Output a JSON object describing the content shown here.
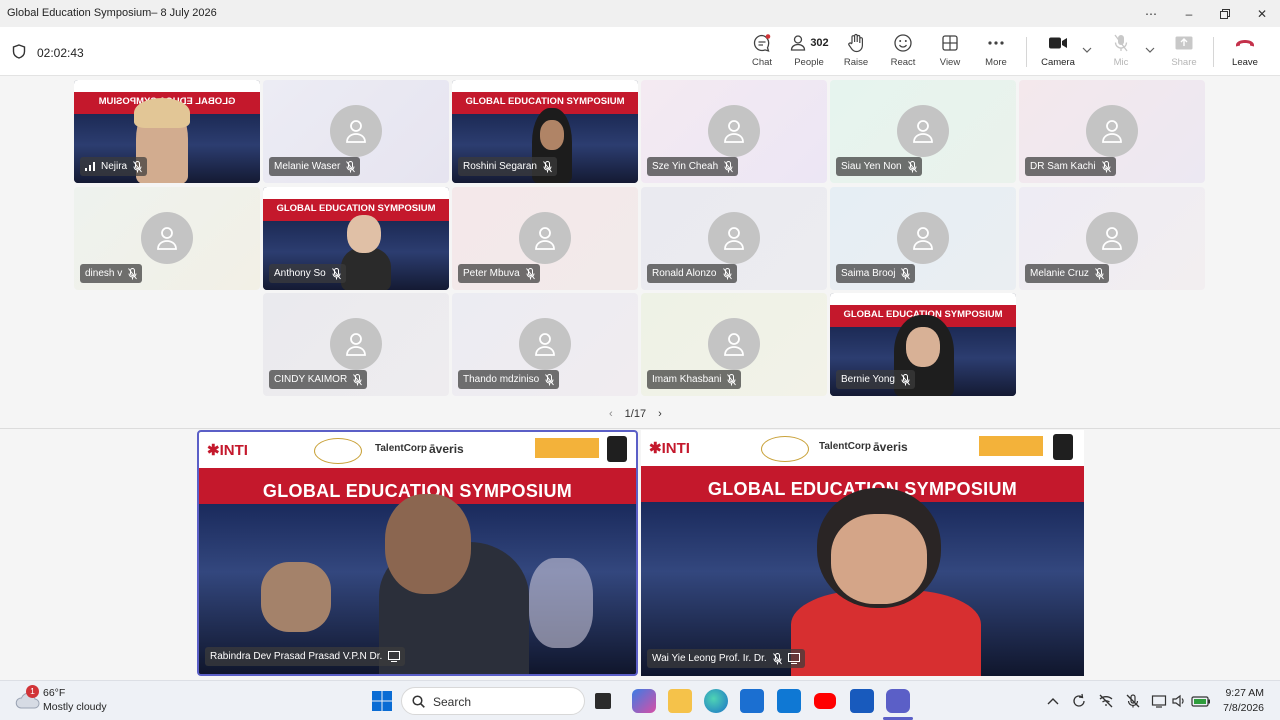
{
  "window": {
    "title": "Global Education Symposium– 8 July 2026"
  },
  "toolbar": {
    "timer": "02:02:43",
    "people_count": "302",
    "buttons": {
      "chat": "Chat",
      "people": "People",
      "raise": "Raise",
      "react": "React",
      "view": "View",
      "more": "More",
      "camera": "Camera",
      "mic": "Mic",
      "share": "Share",
      "leave": "Leave"
    }
  },
  "banner_text": "GLOBAL EDUCATION SYMPOSIUM",
  "banner_text_mirrored": "GLOBAL EDUCA SYMPOSIUM",
  "logos": {
    "inti": "✱INTI",
    "talentcorp": "TalentCorp",
    "averis": "āveris"
  },
  "participants": [
    {
      "name": "Nejira"
    },
    {
      "name": "Melanie Waser"
    },
    {
      "name": "Roshini Segaran"
    },
    {
      "name": "Sze Yin Cheah"
    },
    {
      "name": "Siau Yen Non"
    },
    {
      "name": "DR Sam Kachi"
    },
    {
      "name": "dinesh v"
    },
    {
      "name": "Anthony So"
    },
    {
      "name": "Peter Mbuva"
    },
    {
      "name": "Ronald Alonzo"
    },
    {
      "name": "Saima Brooj"
    },
    {
      "name": "Melanie Cruz"
    },
    {
      "name": "CINDY KAIMOR"
    },
    {
      "name": "Thando mdziniso"
    },
    {
      "name": "Imam Khasbani"
    },
    {
      "name": "Bernie Yong"
    }
  ],
  "pager": {
    "label": "1/17"
  },
  "spotlight": [
    {
      "name": "Rabindra Dev Prasad Prasad V.P.N Dr."
    },
    {
      "name": "Wai Yie Leong Prof. Ir. Dr."
    }
  ],
  "taskbar": {
    "weather_temp": "66°F",
    "weather_desc": "Mostly cloudy",
    "weather_badge": "1",
    "search_label": "Search",
    "time": "9:27 AM",
    "date": "7/8/2026"
  },
  "colors": {
    "leave": "#c4314b",
    "brand_red": "#c4182c",
    "active_border": "#5b5fc7"
  }
}
